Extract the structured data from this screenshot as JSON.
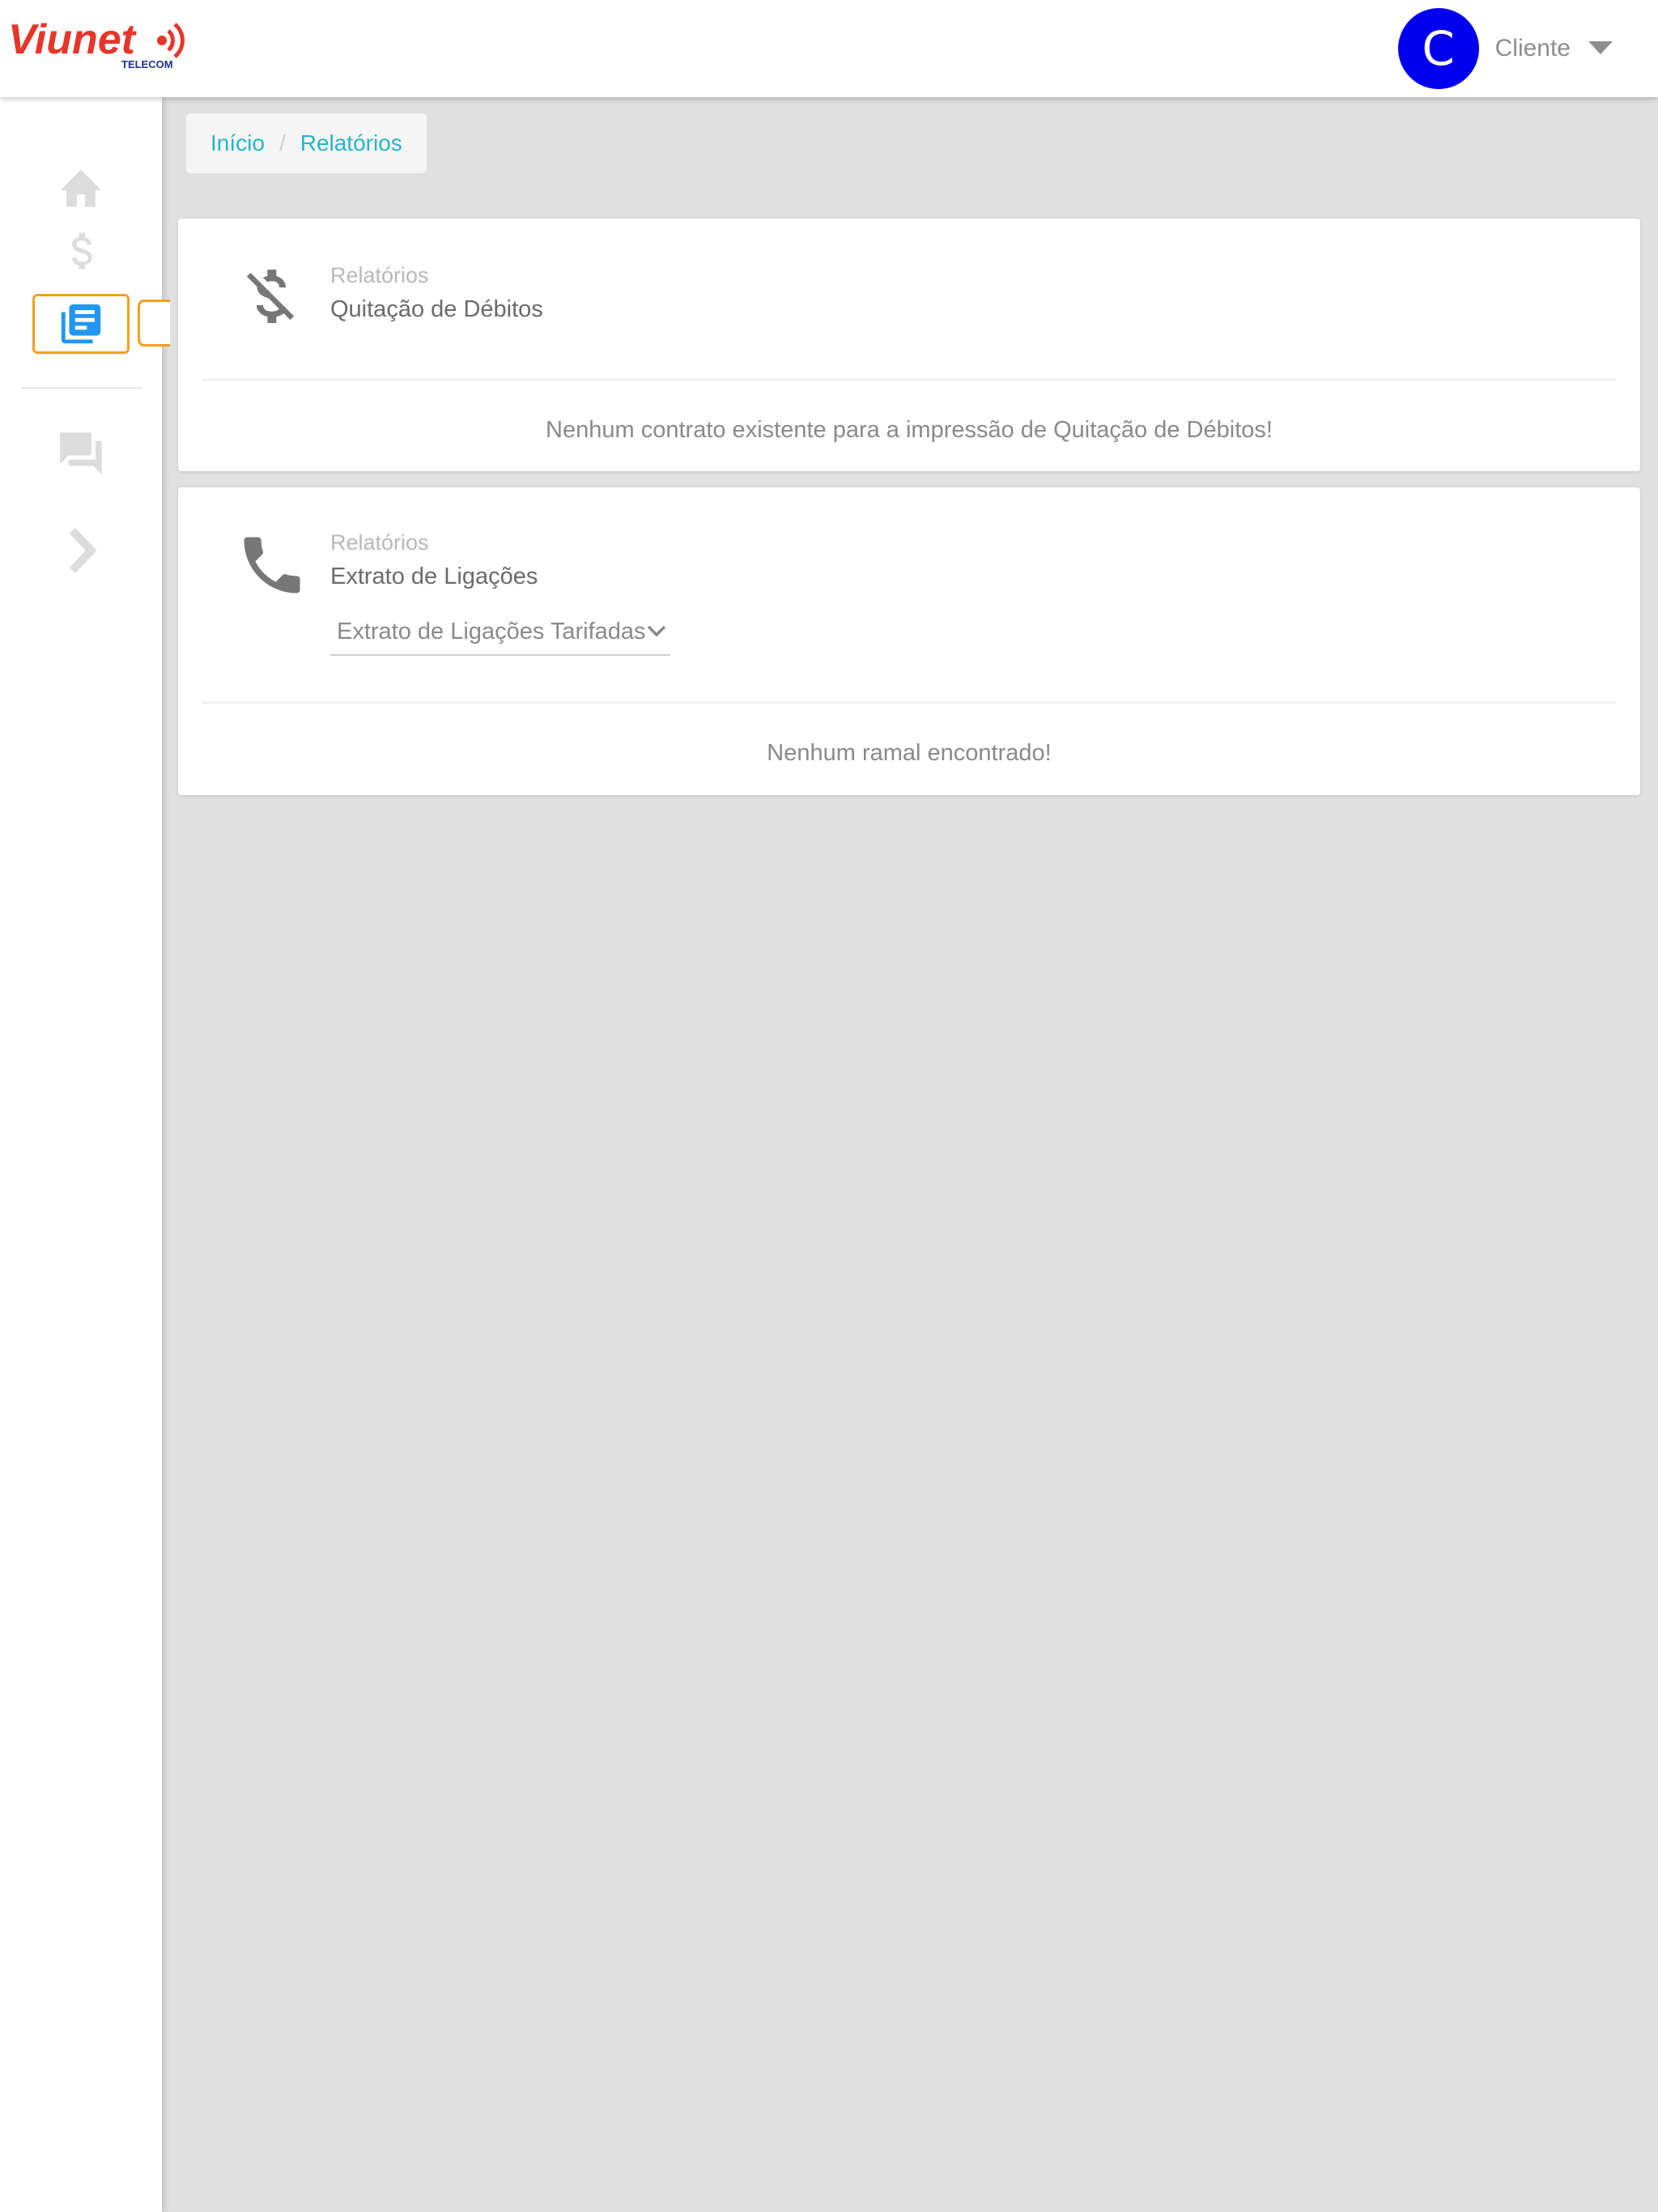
{
  "header": {
    "brand": "Viunet",
    "brand_sub": "TELECOM",
    "user_initial": "C",
    "user_name": "Cliente",
    "icons": {
      "caret": "caret-down-icon"
    }
  },
  "sidebar": {
    "items": [
      {
        "name": "home",
        "icon": "home-icon"
      },
      {
        "name": "financeiro",
        "icon": "dollar-icon"
      },
      {
        "name": "relatorios",
        "icon": "reports-icon",
        "active": true
      },
      {
        "name": "atendimento",
        "icon": "chat-icon"
      },
      {
        "name": "expand",
        "icon": "chevron-right-icon"
      }
    ]
  },
  "breadcrumb": {
    "items": [
      "Início",
      "Relatórios"
    ],
    "separator": "/"
  },
  "cards": [
    {
      "label": "Relatórios",
      "title": "Quitação de Débitos",
      "icon": "money-off-icon",
      "message": "Nenhum contrato existente para a impressão de Quitação de Débitos!"
    },
    {
      "label": "Relatórios",
      "title": "Extrato de Ligações",
      "icon": "phone-icon",
      "select_value": "Extrato de Ligações Tarifadas",
      "message": "Nenhum ramal encontrado!"
    }
  ],
  "colors": {
    "brand_red": "#e8352a",
    "avatar": "#0000ee",
    "link": "#26b5c9",
    "active_icon": "#2196f3",
    "active_outline": "#f0a020",
    "background": "#e0e0e0"
  }
}
